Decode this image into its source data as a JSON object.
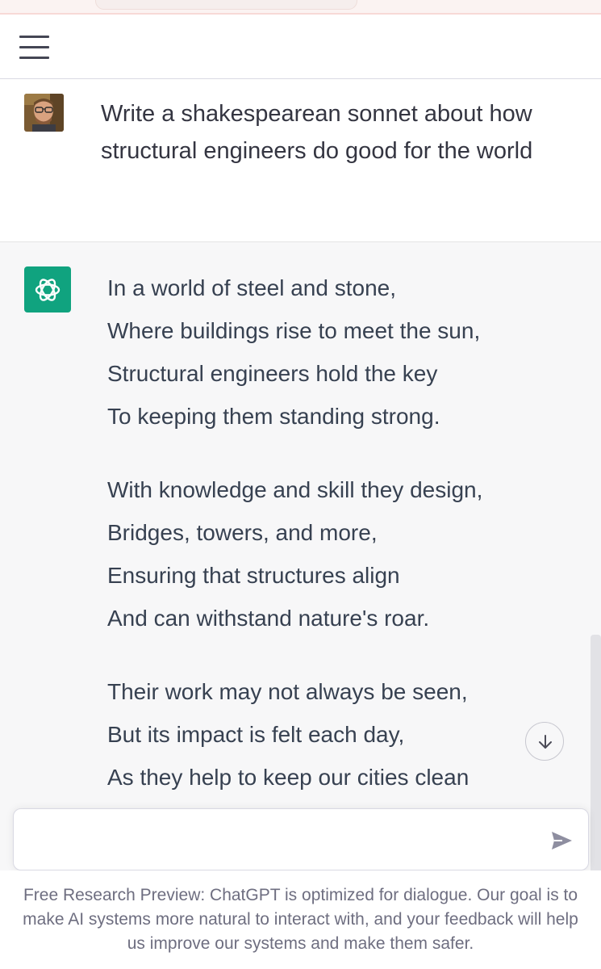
{
  "header": {
    "menu_icon": "hamburger-menu-icon"
  },
  "user_message": {
    "avatar": "user-photo-avatar",
    "text": "Write a shakespearean sonnet about how structural engineers do good for the world"
  },
  "assistant_message": {
    "avatar_icon": "openai-logo-icon",
    "avatar_color": "#10a37f",
    "stanzas": [
      [
        "In a world of steel and stone,",
        "Where buildings rise to meet the sun,",
        "Structural engineers hold the key",
        "To keeping them standing strong."
      ],
      [
        "With knowledge and skill they design,",
        "Bridges, towers, and more,",
        "Ensuring that structures align",
        "And can withstand nature's roar."
      ],
      [
        "Their work may not always be seen,",
        "But its impact is felt each day,",
        "As they help to keep our cities clean"
      ]
    ]
  },
  "scroll_down": {
    "icon": "arrow-down-icon"
  },
  "composer": {
    "value": "",
    "placeholder": "",
    "send_icon": "send-icon"
  },
  "footer": {
    "text": "Free Research Preview: ChatGPT is optimized for dialogue. Our goal is to make AI systems more natural to interact with, and your feedback will help us improve our systems and make them safer."
  }
}
